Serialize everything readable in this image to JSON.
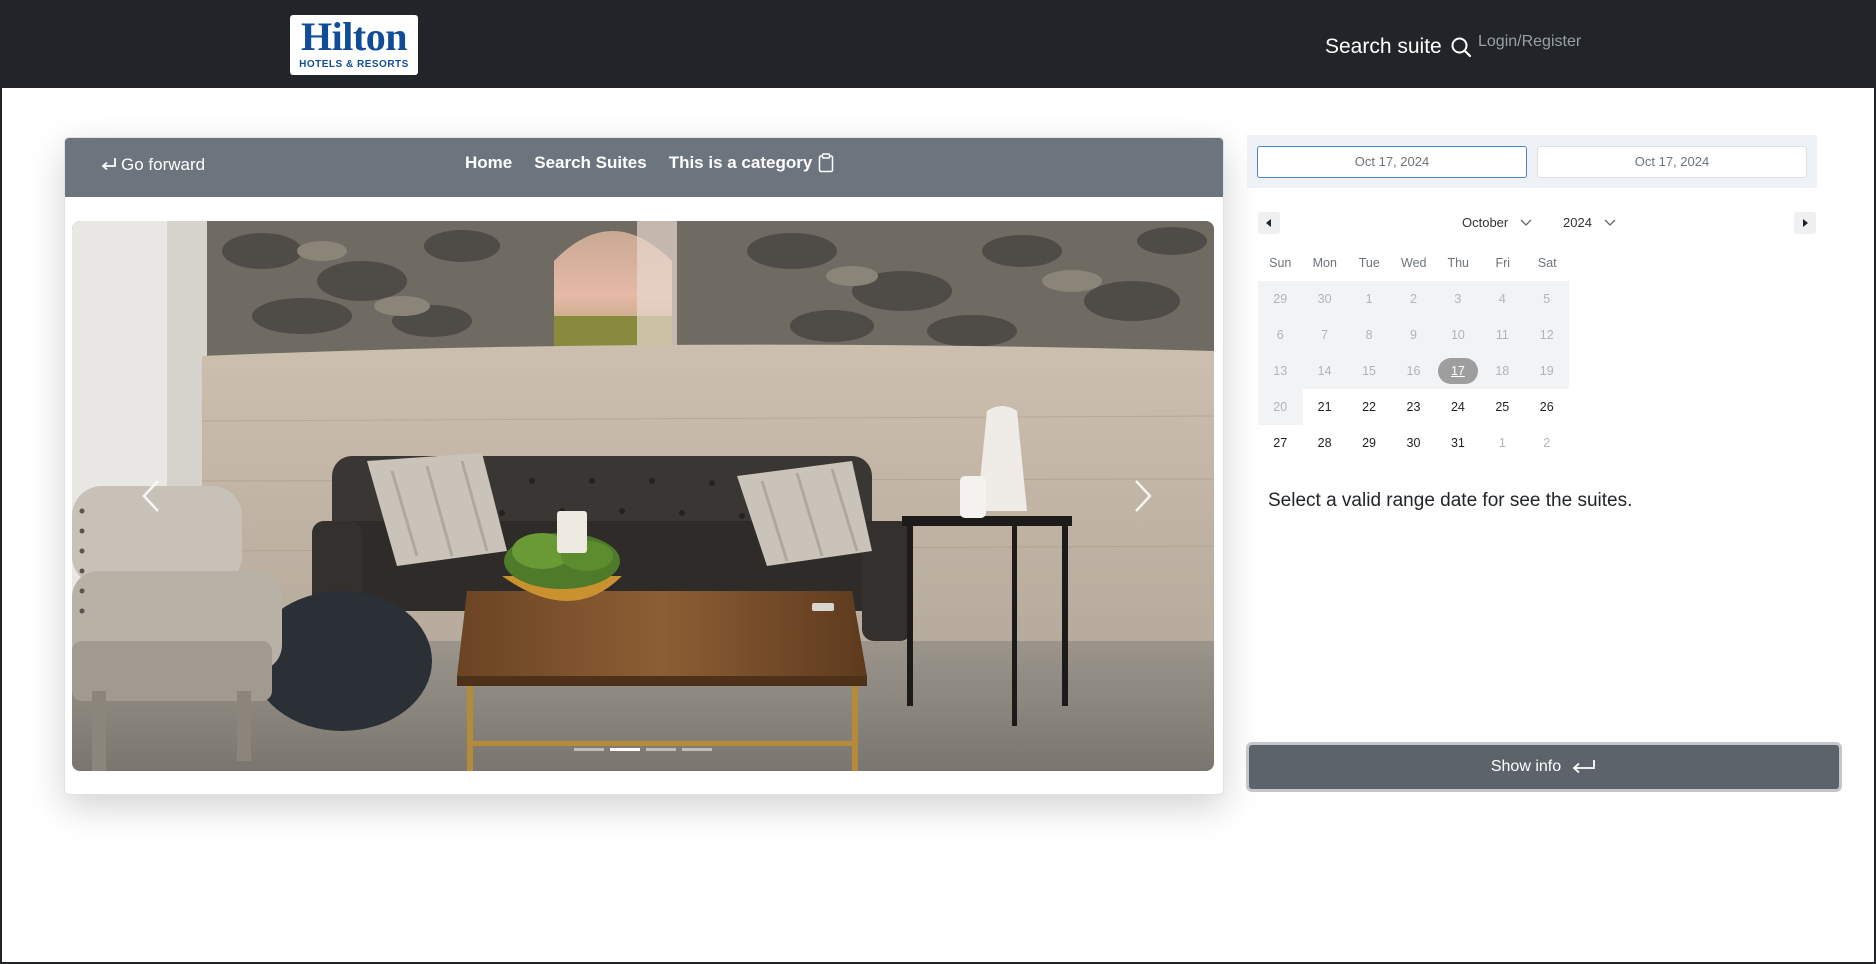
{
  "navbar": {
    "logo_word": "Hilton",
    "logo_sub": "HOTELS & RESORTS",
    "search_label": "Search suite",
    "login_label": "Login/Register"
  },
  "card": {
    "go_forward": "Go forward",
    "menu": [
      "Home",
      "Search Suites"
    ],
    "category_label": "This is a category",
    "carousel": {
      "slides": 4,
      "active_index": 1
    }
  },
  "range": {
    "start": "Oct 17, 2024",
    "end": "Oct 17, 2024"
  },
  "calendar": {
    "month": "October",
    "year": "2024",
    "weekdays": [
      "Sun",
      "Mon",
      "Tue",
      "Wed",
      "Thu",
      "Fri",
      "Sat"
    ],
    "weeks": [
      [
        "29",
        "30",
        "1",
        "2",
        "3",
        "4",
        "5"
      ],
      [
        "6",
        "7",
        "8",
        "9",
        "10",
        "11",
        "12"
      ],
      [
        "13",
        "14",
        "15",
        "16",
        "17",
        "18",
        "19"
      ],
      [
        "20",
        "21",
        "22",
        "23",
        "24",
        "25",
        "26"
      ],
      [
        "27",
        "28",
        "29",
        "30",
        "31",
        "1",
        "2"
      ]
    ],
    "selected": "17"
  },
  "message": "Select a valid range date for see the suites.",
  "show_info_label": "Show info",
  "colors": {
    "navbar": "#212529",
    "card_header": "#6c757d",
    "button": "#5c636a",
    "brand": "#104c97"
  }
}
